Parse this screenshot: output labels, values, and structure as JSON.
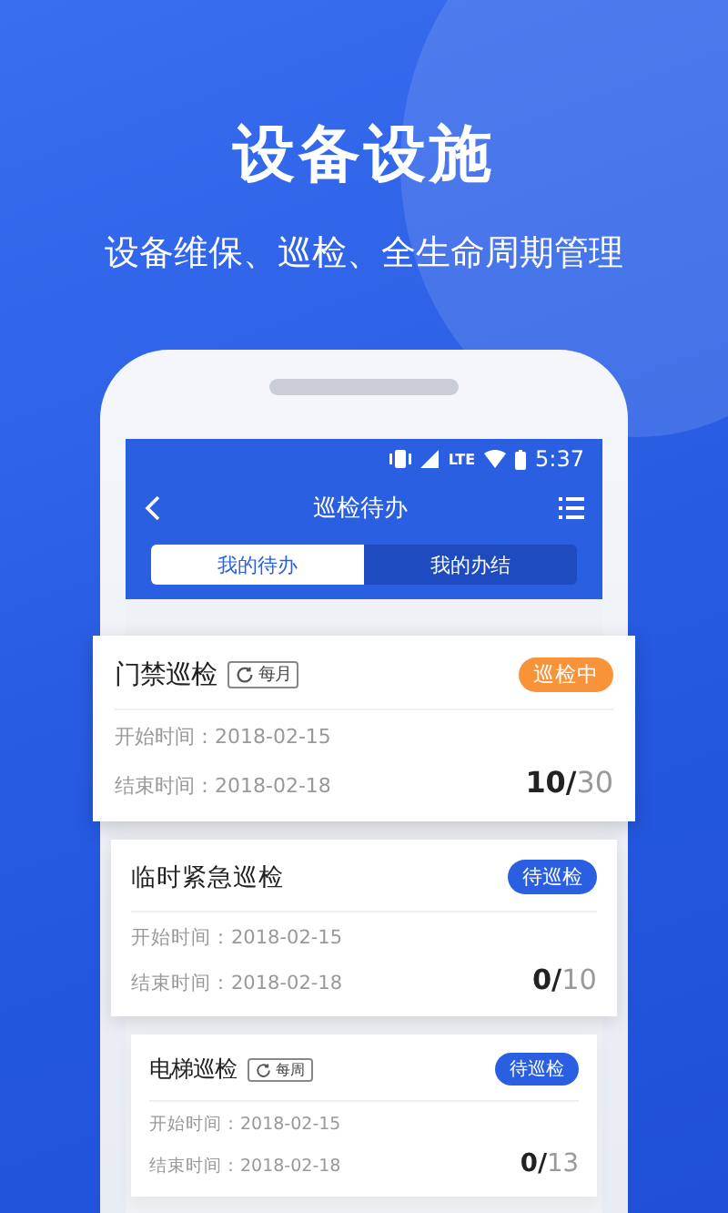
{
  "headline": "设备设施",
  "subtitle": "设备维保、巡检、全生命周期管理",
  "status_bar": {
    "network": "LTE",
    "time": "5:37"
  },
  "header": {
    "title": "巡检待办"
  },
  "tabs": [
    {
      "label": "我的待办",
      "selected": true
    },
    {
      "label": "我的办结",
      "selected": false
    }
  ],
  "tasks": [
    {
      "name": "门禁巡检",
      "cycle": "每月",
      "status": {
        "label": "巡检中",
        "kind": "active"
      },
      "start_label": "开始时间：",
      "start": "2018-02-15",
      "end_label": "结束时间：",
      "end": "2018-02-18",
      "done": "10/",
      "total": "30"
    },
    {
      "name": "临时紧急巡检",
      "status": {
        "label": "待巡检",
        "kind": "pending"
      },
      "start_label": "开始时间：",
      "start": "2018-02-15",
      "end_label": "结束时间：",
      "end": "2018-02-18",
      "done": "0/",
      "total": "10"
    },
    {
      "name": "电梯巡检",
      "cycle": "每周",
      "status": {
        "label": "待巡检",
        "kind": "pending"
      },
      "start_label": "开始时间：",
      "start": "2018-02-15",
      "end_label": "结束时间：",
      "end": "2018-02-18",
      "done": "0/",
      "total": "13"
    }
  ]
}
